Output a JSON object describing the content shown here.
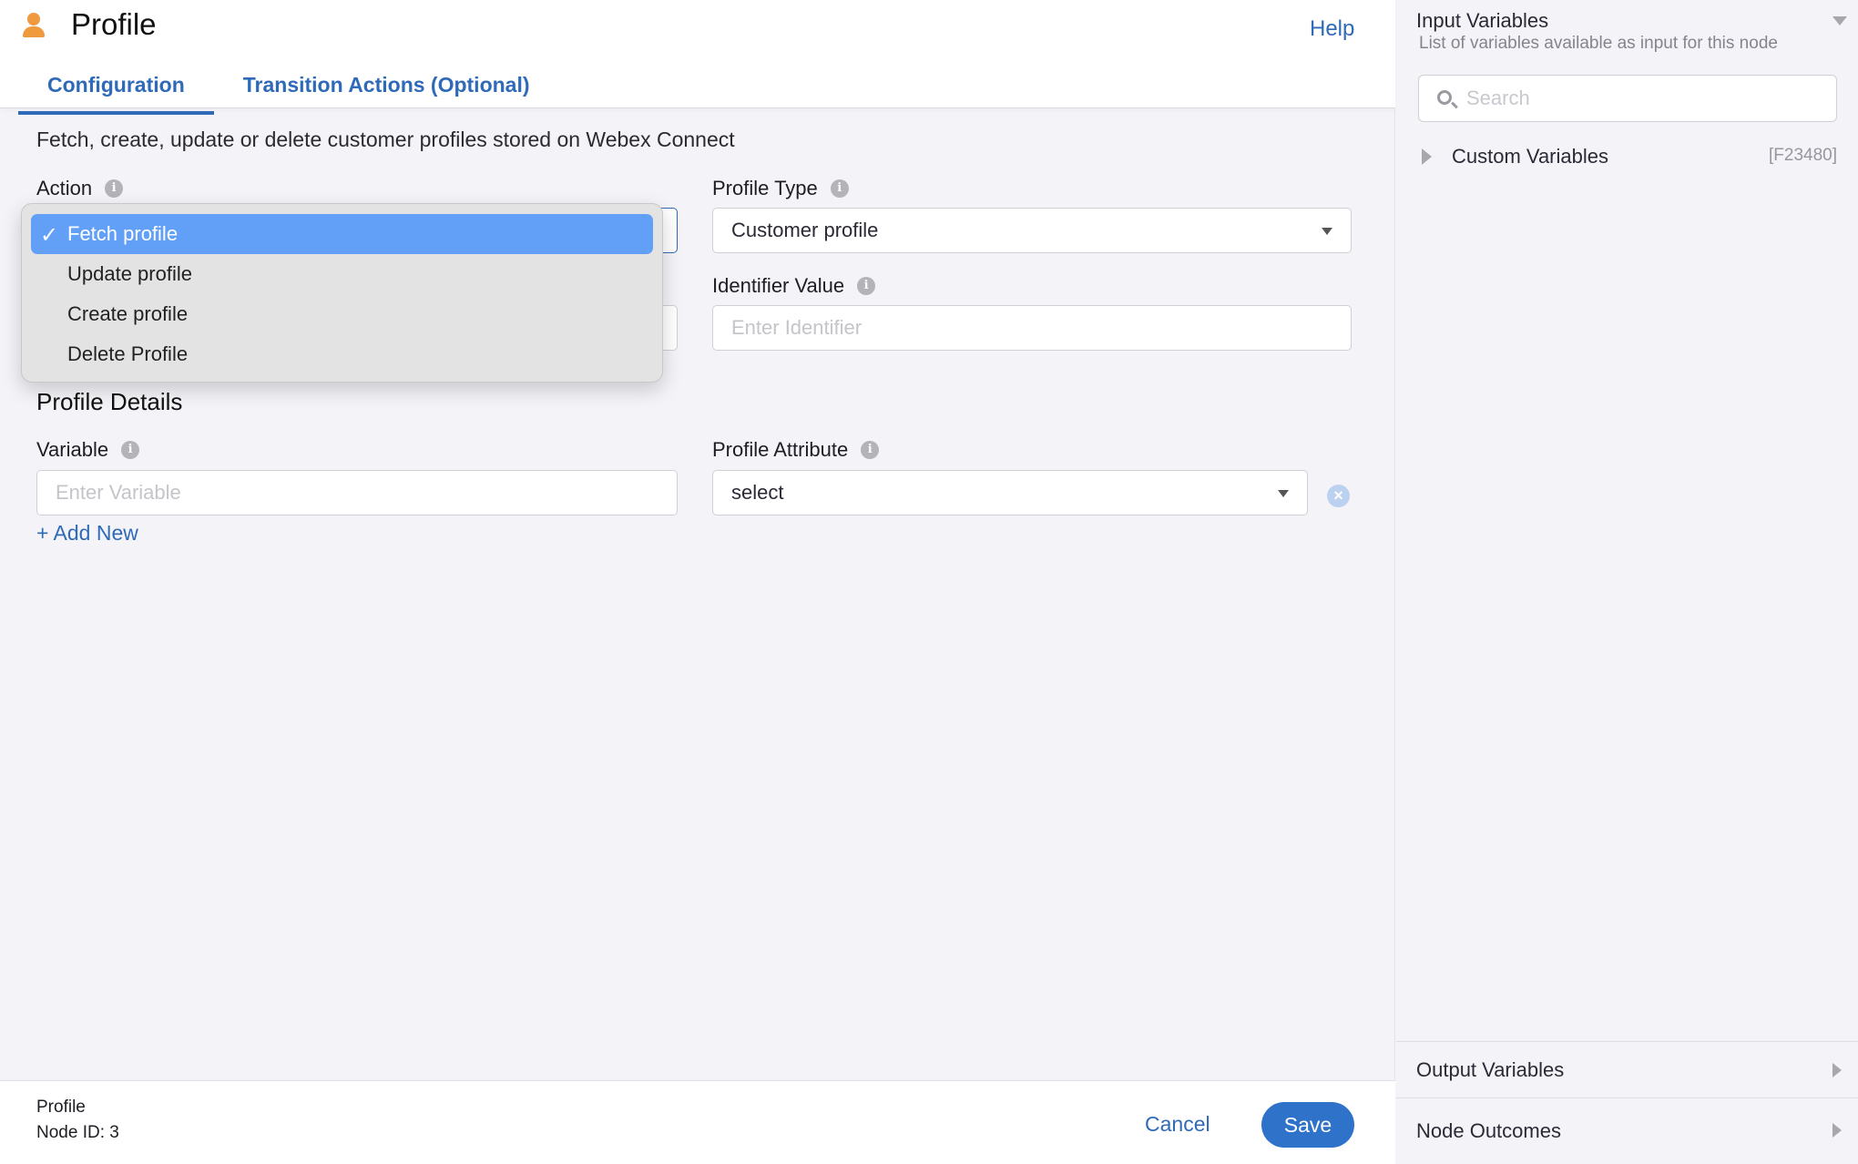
{
  "header": {
    "title": "Profile",
    "icon": "person-icon",
    "help_label": "Help",
    "tabs": [
      {
        "label": "Configuration",
        "active": true
      },
      {
        "label": "Transition Actions (Optional)",
        "active": false
      }
    ]
  },
  "main": {
    "description": "Fetch, create, update or delete customer profiles stored on Webex Connect",
    "action": {
      "label": "Action",
      "selected": "Fetch profile",
      "options": [
        "Fetch profile",
        "Update profile",
        "Create profile",
        "Delete Profile"
      ]
    },
    "profile_type": {
      "label": "Profile Type",
      "value": "Customer profile"
    },
    "identifier_value": {
      "label": "Identifier Value",
      "placeholder": "Enter Identifier"
    },
    "profile_details": {
      "title": "Profile Details",
      "variable_label": "Variable",
      "variable_placeholder": "Enter Variable",
      "attribute_label": "Profile Attribute",
      "attribute_value": "select",
      "add_new_label": "+ Add New"
    }
  },
  "footer": {
    "node_name": "Profile",
    "node_id": "Node ID: 3",
    "cancel_label": "Cancel",
    "save_label": "Save"
  },
  "sidebar": {
    "input_variables": {
      "title": "Input Variables",
      "subtitle": "List of variables available as input for this node",
      "search_placeholder": "Search",
      "tree": [
        {
          "label": "Custom Variables",
          "code": "[F23480]"
        }
      ]
    },
    "output_variables_label": "Output Variables",
    "node_outcomes_label": "Node Outcomes"
  },
  "colors": {
    "accent": "#2f6ab8",
    "selected_option": "#62a0f8",
    "icon_orange": "#ef9a3f"
  }
}
